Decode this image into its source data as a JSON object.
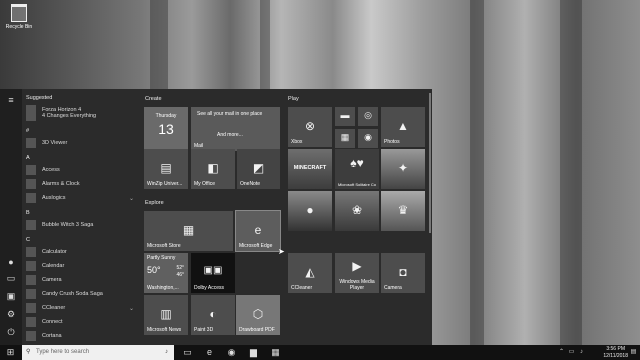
{
  "desktop": {
    "recycle_bin_label": "Recycle Bin"
  },
  "applist": {
    "suggested_header": "Suggested",
    "suggested_app": {
      "name": "Forza Horizon 4",
      "tagline": "4 Changes Everything"
    },
    "groups": [
      {
        "letter": "#",
        "apps": [
          {
            "name": "3D Viewer"
          }
        ]
      },
      {
        "letter": "A",
        "apps": [
          {
            "name": "Access"
          },
          {
            "name": "Alarms & Clock"
          },
          {
            "name": "Auslogics",
            "expand": "⌄"
          }
        ]
      },
      {
        "letter": "B",
        "apps": [
          {
            "name": "Bubble Witch 3 Saga"
          }
        ]
      },
      {
        "letter": "C",
        "apps": [
          {
            "name": "Calculator"
          },
          {
            "name": "Calendar"
          },
          {
            "name": "Camera"
          },
          {
            "name": "Candy Crush Soda Saga"
          },
          {
            "name": "CCleaner",
            "expand": "⌄"
          },
          {
            "name": "Connect"
          },
          {
            "name": "Cortana"
          }
        ]
      }
    ]
  },
  "create": {
    "title": "Create",
    "calendar_day": "Thursday",
    "calendar_date": "13",
    "mail_text": "See all your mail in one place",
    "mail_more": "And more...",
    "mail_label": "Mail",
    "winzip_label": "WinZip Univer...",
    "office_label": "My Office",
    "onenote_label": "OneNote"
  },
  "explore": {
    "title": "Explore",
    "store_label": "Microsoft Store",
    "edge_label": "Microsoft Edge",
    "weather_condition": "Partly Sunny",
    "weather_temp": "50°",
    "weather_high": "52°",
    "weather_low": "46°",
    "weather_location": "Washington,...",
    "dolby_label": "Dolby Access",
    "news_label": "Microsoft News",
    "paint3d_label": "Paint 3D",
    "drawboard_label": "Drawboard PDF"
  },
  "play": {
    "title": "Play",
    "xbox_label": "Xbox",
    "photos_label": "Photos",
    "minecraft_label": "MINECRAFT",
    "solitaire_label": "Microsoft Solitaire Collection",
    "ccleaner_label": "CCleaner",
    "media_label": "Windows Media Player",
    "camera_label": "Camera"
  },
  "taskbar": {
    "search_placeholder": "Type here to search",
    "time": "3:56 PM",
    "date": "12/11/2018"
  }
}
